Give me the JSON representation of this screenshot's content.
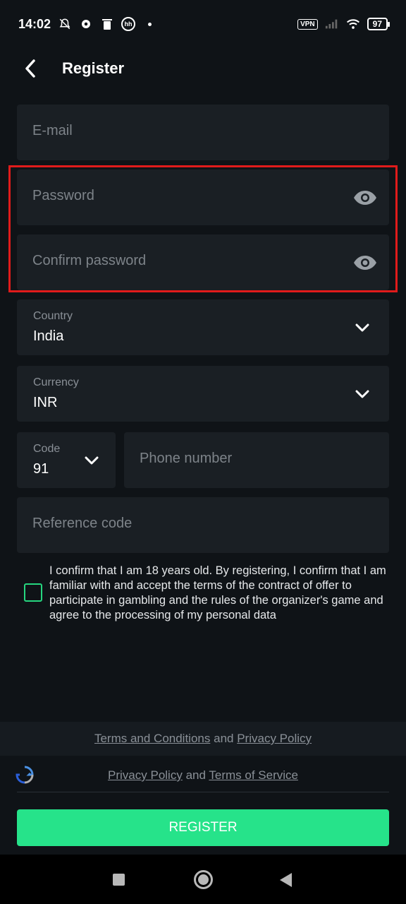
{
  "status_bar": {
    "time": "14:02",
    "hh_icon_text": "hh",
    "vpn_label": "VPN",
    "battery": "97"
  },
  "header": {
    "title": "Register"
  },
  "form": {
    "email_placeholder": "E-mail",
    "password_placeholder": "Password",
    "confirm_password_placeholder": "Confirm password",
    "country": {
      "label": "Country",
      "value": "India"
    },
    "currency": {
      "label": "Currency",
      "value": "INR"
    },
    "code": {
      "label": "Code",
      "value": "91"
    },
    "phone_placeholder": "Phone number",
    "reference_placeholder": "Reference code"
  },
  "consent": {
    "text": "I confirm that I am 18 years old. By registering, I confirm that I am familiar with and accept the terms of the contract of offer to participate in gambling and the rules of the organizer's game and agree to the processing of my personal data",
    "checked": false
  },
  "footer": {
    "terms_link": "Terms and Conditions",
    "and1": "and",
    "privacy_link": "Privacy Policy",
    "privacy_link2": "Privacy Policy",
    "and2": "and",
    "tos_link": "Terms of Service"
  },
  "register_button": "REGISTER",
  "colors": {
    "background": "#0f1317",
    "field": "#1a1f24",
    "accent": "#26e38a",
    "highlight": "#e01b1b"
  }
}
